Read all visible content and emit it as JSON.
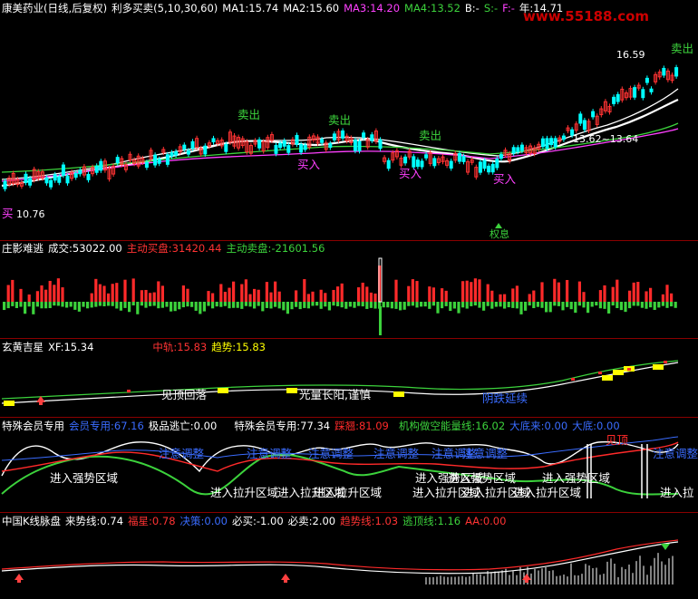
{
  "colors": {
    "bg": "#000000",
    "up": "#ff3333",
    "down": "#00ffff",
    "white": "#ffffff",
    "yellow": "#ffff00",
    "magenta": "#ff40ff",
    "green": "#3cd23c",
    "red": "#ff2a2a",
    "blue": "#3a6cff",
    "sep": "#8a0000"
  },
  "header": {
    "stock": "康美药业(日线,后复权)",
    "indicator": "利多买卖(5,10,30,60)",
    "ma1": "MA1:15.74",
    "ma2": "MA2:15.60",
    "ma3": "MA3:14.20",
    "ma4": "MA4:13.52",
    "b": "B:-",
    "s": "S:-",
    "f": "F:-",
    "year": "年:14.71",
    "watermark": "www.55188.com"
  },
  "price_panel": {
    "signals_sell": [
      "卖出",
      "卖出",
      "卖出",
      "卖出"
    ],
    "signals_buy": [
      "买入",
      "买入",
      "买入"
    ],
    "low_label": "10.76",
    "high_label": "16.59",
    "mid_label": "13.62~13.64",
    "left_buy": "买",
    "bottom_mark": "权息"
  },
  "volume_panel": {
    "title": "庄影难逃",
    "vol": "成交:53022.00",
    "buy": "主动买盘:31420.44",
    "sell": "主动卖盘:-21601.56"
  },
  "xuanhuang_panel": {
    "title": "玄黄吉星",
    "xf": "XF:15.34",
    "zhonggui": "中轨:15.83",
    "qushi": "趋势:15.83",
    "notes": [
      "见顶回落",
      "光量长阳,谨慎",
      "阴跌延续"
    ]
  },
  "member_panel": {
    "title": "特殊会员专用",
    "m1": "会员专用:67.16",
    "m2": "极品逃亡:0.00",
    "m3": "特殊会员专用:77.34",
    "m4": "踩翘:81.09",
    "m5": "机构做空能量线:16.02",
    "m6": "大底来:0.00",
    "m7": "大底:0.00",
    "zones_top": [
      "注意调整",
      "注意调整",
      "注意调整",
      "注意调整",
      "注意调整",
      "注意调整",
      "注意调整",
      "见顶",
      "注意调整"
    ],
    "zones_mid": [
      "进入强势区域",
      "进入强势区域",
      "进入强势区域",
      "进入强势区域"
    ],
    "zones_bot": [
      "进入拉升区域",
      "进入拉升区域",
      "进入拉升区域",
      "进入拉升区域",
      "进入拉升区域",
      "进入拉升区域",
      "进入拉"
    ]
  },
  "kline_panel": {
    "title": "中国K线脉盘",
    "laishi": "来势线:0.74",
    "fuxing": "福星:0.78",
    "juece": "决策:0.00",
    "bimai": "必买:-1.00",
    "bimai2": "必卖:2.00",
    "qushixian": "趋势线:1.03",
    "taodingxian": "逃顶线:1.16",
    "aa": "AA:0.00"
  }
}
